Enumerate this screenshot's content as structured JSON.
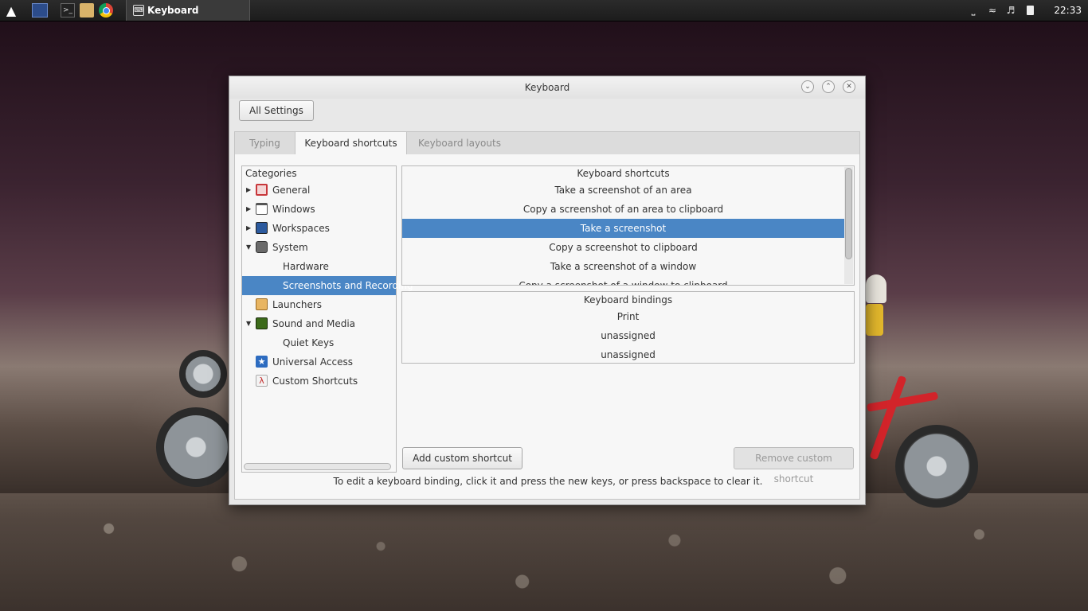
{
  "panel": {
    "clock": "22:33",
    "task_title": "Keyboard"
  },
  "window": {
    "title": "Keyboard",
    "all_settings_label": "All Settings",
    "tabs": [
      {
        "label": "Typing",
        "active": false
      },
      {
        "label": "Keyboard shortcuts",
        "active": true
      },
      {
        "label": "Keyboard layouts",
        "active": false
      }
    ]
  },
  "categories": {
    "header": "Categories",
    "items": [
      {
        "label": "General",
        "expander": "right",
        "icon": "general-icon",
        "color": "#c8373b",
        "sub": false,
        "selected": false
      },
      {
        "label": "Windows",
        "expander": "right",
        "icon": "windows-icon",
        "color": "#ffffff",
        "sub": false,
        "selected": false
      },
      {
        "label": "Workspaces",
        "expander": "right",
        "icon": "workspaces-icon",
        "color": "#2c5a9e",
        "sub": false,
        "selected": false
      },
      {
        "label": "System",
        "expander": "down",
        "icon": "system-icon",
        "color": "#555555",
        "sub": false,
        "selected": false
      },
      {
        "label": "Hardware",
        "expander": "",
        "icon": "",
        "color": "",
        "sub": true,
        "selected": false
      },
      {
        "label": "Screenshots and Recording",
        "expander": "",
        "icon": "",
        "color": "",
        "sub": true,
        "selected": true
      },
      {
        "label": "Launchers",
        "expander": "",
        "icon": "launchers-icon",
        "color": "#d7a04a",
        "sub": false,
        "selected": false
      },
      {
        "label": "Sound and Media",
        "expander": "down",
        "icon": "sound-media-icon",
        "color": "#3c6a1a",
        "sub": false,
        "selected": false
      },
      {
        "label": "Quiet Keys",
        "expander": "",
        "icon": "",
        "color": "",
        "sub": true,
        "selected": false
      },
      {
        "label": "Universal Access",
        "expander": "",
        "icon": "universal-access-icon",
        "color": "#2d6cc0",
        "sub": false,
        "selected": false
      },
      {
        "label": "Custom Shortcuts",
        "expander": "",
        "icon": "custom-shortcuts-icon",
        "color": "#c22a2a",
        "sub": false,
        "selected": false
      }
    ]
  },
  "shortcuts": {
    "header": "Keyboard shortcuts",
    "items": [
      {
        "label": "Take a screenshot of an area",
        "selected": false
      },
      {
        "label": "Copy a screenshot of an area to clipboard",
        "selected": false
      },
      {
        "label": "Take a screenshot",
        "selected": true
      },
      {
        "label": "Copy a screenshot to clipboard",
        "selected": false
      },
      {
        "label": "Take a screenshot of a window",
        "selected": false
      },
      {
        "label": "Copy a screenshot of a window to clipboard",
        "selected": false
      }
    ]
  },
  "bindings": {
    "header": "Keyboard bindings",
    "items": [
      "Print",
      "unassigned",
      "unassigned"
    ]
  },
  "buttons": {
    "add": "Add custom shortcut",
    "remove": "Remove custom shortcut"
  },
  "hint": "To edit a keyboard binding, click it and press the new keys, or press backspace to clear it.",
  "colors": {
    "selection": "#4a86c5"
  }
}
